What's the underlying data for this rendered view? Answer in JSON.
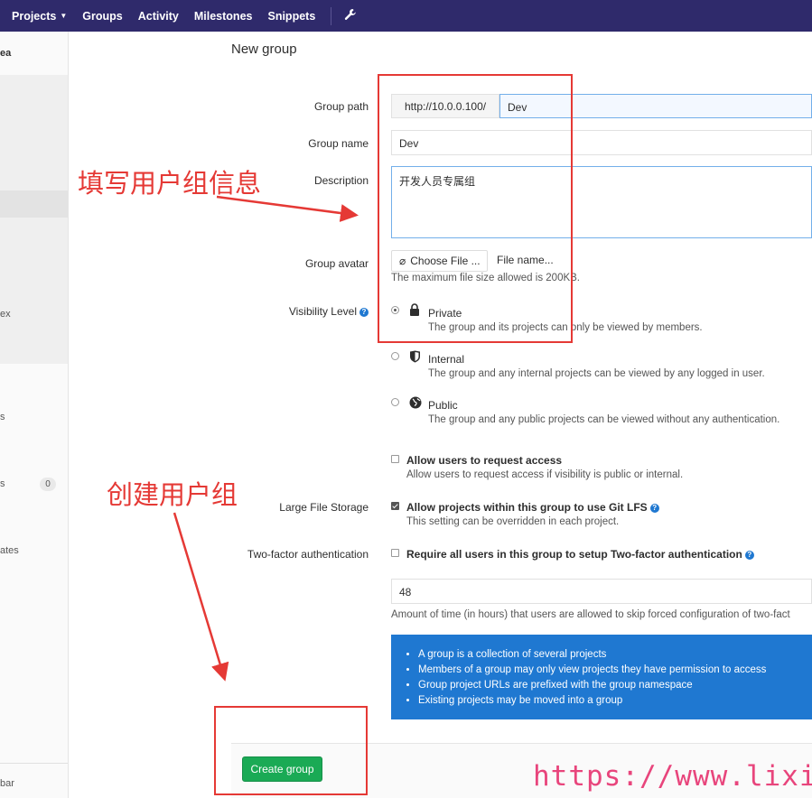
{
  "navbar": {
    "items": [
      {
        "label": "Projects",
        "has_caret": true
      },
      {
        "label": "Groups"
      },
      {
        "label": "Activity"
      },
      {
        "label": "Milestones"
      },
      {
        "label": "Snippets"
      }
    ],
    "wrench_icon": "wrench-icon"
  },
  "sidebar": {
    "frag_area": "ea",
    "frag_ex": "ex",
    "frag_s1": "s",
    "frag_s2": "s",
    "badge": "0",
    "frag_ates": "ates",
    "frag_bar": "bar"
  },
  "page": {
    "title": "New group"
  },
  "form": {
    "group_path": {
      "label": "Group path",
      "prefix": "http://10.0.0.100/",
      "value": "Dev"
    },
    "group_name": {
      "label": "Group name",
      "value": "Dev"
    },
    "description": {
      "label": "Description",
      "value": "开发人员专属组"
    },
    "avatar": {
      "label": "Group avatar",
      "button": "Choose File ...",
      "filename": "File name...",
      "hint": "The maximum file size allowed is 200KB."
    },
    "visibility": {
      "label": "Visibility Level",
      "options": [
        {
          "name": "Private",
          "desc": "The group and its projects can only be viewed by members.",
          "selected": true,
          "icon": "lock-icon"
        },
        {
          "name": "Internal",
          "desc": "The group and any internal projects can be viewed by any logged in user.",
          "selected": false,
          "icon": "shield-icon"
        },
        {
          "name": "Public",
          "desc": "The group and any public projects can be viewed without any authentication.",
          "selected": false,
          "icon": "globe-icon"
        }
      ]
    },
    "request_access": {
      "title": "Allow users to request access",
      "desc": "Allow users to request access if visibility is public or internal.",
      "checked": false
    },
    "lfs": {
      "label": "Large File Storage",
      "title": "Allow projects within this group to use Git LFS",
      "desc": "This setting can be overridden in each project.",
      "checked": true
    },
    "two_factor": {
      "label": "Two-factor authentication",
      "title": "Require all users in this group to setup Two-factor authentication",
      "checked": false,
      "grace_value": "48",
      "grace_hint": "Amount of time (in hours) that users are allowed to skip forced configuration of two-fact"
    }
  },
  "info": {
    "items": [
      "A group is a collection of several projects",
      "Members of a group may only view projects they have permission to access",
      "Group project URLs are prefixed with the group namespace",
      "Existing projects may be moved into a group"
    ]
  },
  "actions": {
    "create": "Create group"
  },
  "annotations": {
    "fill_info": "填写用户组信息",
    "create_group": "创建用户组",
    "watermark": "https://www.lixian.fun",
    "color": "#e53935"
  },
  "colors": {
    "navbar": "#2f2a6b",
    "info_bg": "#1f78d1",
    "create_btn": "#1aaa55",
    "watermark": "#e8457c"
  }
}
